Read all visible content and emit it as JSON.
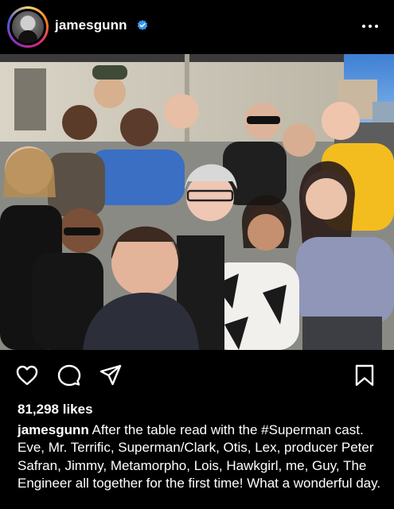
{
  "post": {
    "username": "jamesgunn",
    "verified_icon": "verified-badge-icon",
    "more_icon": "more-options-icon",
    "photo_alt_icon": "group-selfie-photo",
    "likes": "81,298 likes",
    "caption": "After the table read with the #Superman cast. Eve, Mr. Terrific, Superman/Clark, Otis, Lex, producer Peter Safran, Jimmy, Metamorpho, Lois, Hawkgirl, me, Guy, The Engineer all together for the first time! What a wonderful day."
  },
  "actions": {
    "like_icon": "heart-icon",
    "comment_icon": "comment-icon",
    "share_icon": "send-icon",
    "save_icon": "bookmark-icon"
  },
  "colors": {
    "background": "#000000",
    "text": "#ffffff",
    "verified": "#3897f0"
  }
}
